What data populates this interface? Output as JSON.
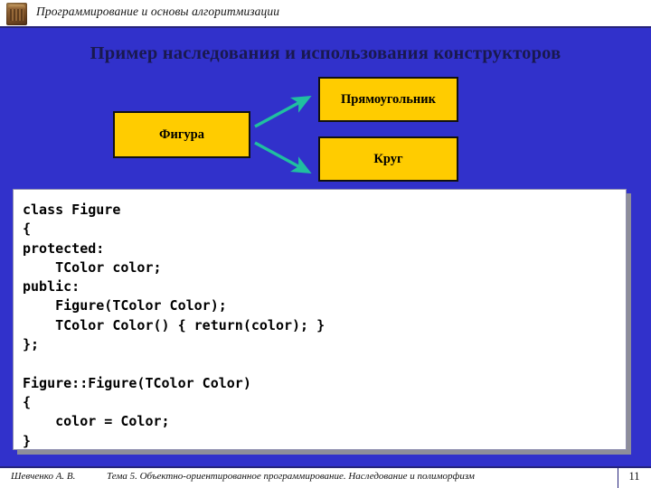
{
  "header": {
    "icon": "building-icon",
    "title": "Программирование и основы алгоритмизации"
  },
  "slide": {
    "title": "Пример наследования и использования конструкторов",
    "background_color": "#3131CB"
  },
  "diagram": {
    "node_fill_color": "#FFCC00",
    "node_border_color": "#111111",
    "arrow_color": "#20BFA0",
    "nodes": [
      {
        "id": "figura",
        "label": "Фигура"
      },
      {
        "id": "rectangle",
        "label": "Прямоугольник"
      },
      {
        "id": "circle",
        "label": "Круг"
      }
    ],
    "arrows": [
      {
        "from": "figura",
        "to": "rectangle"
      },
      {
        "from": "figura",
        "to": "circle"
      }
    ]
  },
  "code_panel": {
    "language": "cpp",
    "background_color": "#FFFFFF",
    "lines": [
      "class Figure",
      "{",
      "protected:",
      "    TColor color;",
      "public:",
      "    Figure(TColor Color);",
      "    TColor Color() { return(color); }",
      "};",
      "",
      "Figure::Figure(TColor Color)",
      "{",
      "    color = Color;",
      "}"
    ],
    "text": "class Figure\n{\nprotected:\n    TColor color;\npublic:\n    Figure(TColor Color);\n    TColor Color() { return(color); }\n};\n\nFigure::Figure(TColor Color)\n{\n    color = Color;\n}"
  },
  "footer": {
    "author": "Шевченко А. В.",
    "topic": "Тема 5. Объектно-ориентированное программирование. Наследование и полиморфизм",
    "page": "11"
  }
}
